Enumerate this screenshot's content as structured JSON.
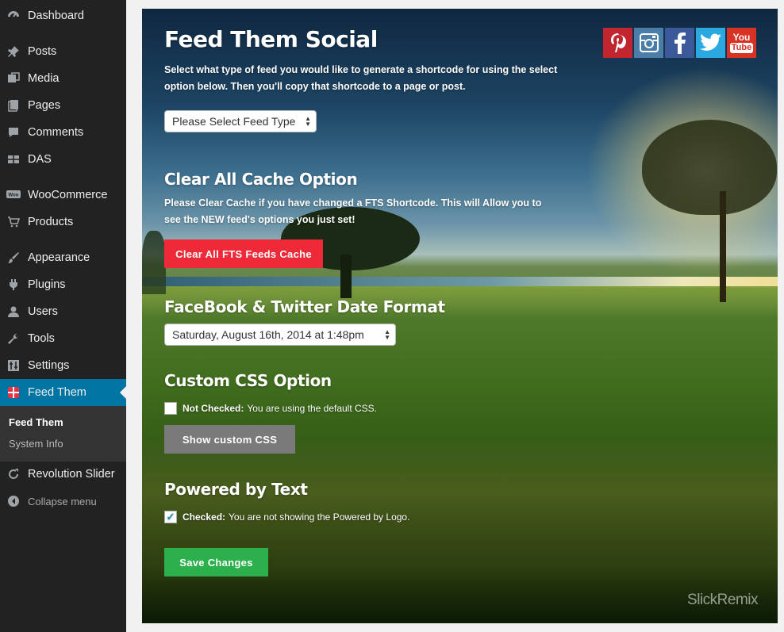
{
  "sidebar": {
    "items": [
      {
        "label": "Dashboard",
        "icon": "dashboard-icon"
      },
      {
        "label": "Posts",
        "icon": "pin-icon"
      },
      {
        "label": "Media",
        "icon": "media-icon"
      },
      {
        "label": "Pages",
        "icon": "pages-icon"
      },
      {
        "label": "Comments",
        "icon": "comment-icon"
      },
      {
        "label": "DAS",
        "icon": "das-icon"
      },
      {
        "label": "WooCommerce",
        "icon": "woocommerce-icon"
      },
      {
        "label": "Products",
        "icon": "cart-icon"
      },
      {
        "label": "Appearance",
        "icon": "brush-icon"
      },
      {
        "label": "Plugins",
        "icon": "plugin-icon"
      },
      {
        "label": "Users",
        "icon": "user-icon"
      },
      {
        "label": "Tools",
        "icon": "wrench-icon"
      },
      {
        "label": "Settings",
        "icon": "settings-icon"
      },
      {
        "label": "Feed Them",
        "icon": "feed-them-icon",
        "active": true
      },
      {
        "label": "Revolution Slider",
        "icon": "refresh-icon"
      }
    ],
    "submenu": [
      {
        "label": "Feed Them",
        "current": true
      },
      {
        "label": "System Info"
      }
    ],
    "collapse_label": "Collapse menu"
  },
  "main": {
    "title": "Feed Them Social",
    "intro": "Select what type of feed you would like to generate a shortcode for using the select option below. Then you'll copy that shortcode to a page or post.",
    "feed_select": {
      "selected": "Please Select Feed Type"
    },
    "cache": {
      "heading": "Clear All Cache Option",
      "description": "Please Clear Cache if you have changed a FTS Shortcode. This will Allow you to see the NEW feed's options you just set!",
      "button": "Clear All FTS Feeds Cache"
    },
    "date_format": {
      "heading": "FaceBook & Twitter Date Format",
      "selected": "Saturday, August 16th, 2014 at 1:48pm"
    },
    "custom_css": {
      "heading": "Custom CSS Option",
      "checked": false,
      "status_bold": "Not Checked:",
      "status_text": "You are using the default CSS.",
      "button": "Show custom CSS"
    },
    "powered_by": {
      "heading": "Powered by Text",
      "checked": true,
      "status_bold": "Checked:",
      "status_text": "You are not showing the Powered by Logo."
    },
    "save_button": "Save Changes",
    "social": {
      "youtube_top": "You",
      "youtube_bottom": "Tube"
    },
    "watermark": "SlickRemix"
  },
  "colors": {
    "sidebar_bg": "#222222",
    "active_blue": "#0074a2",
    "clear_button": "#ee2a38",
    "css_button": "#7a7a7a",
    "save_button": "#2bb04c",
    "pinterest": "#c1262e",
    "instagram": "#4a7ea8",
    "facebook": "#3b5998",
    "twitter": "#29a9e0",
    "youtube": "#d83225"
  }
}
